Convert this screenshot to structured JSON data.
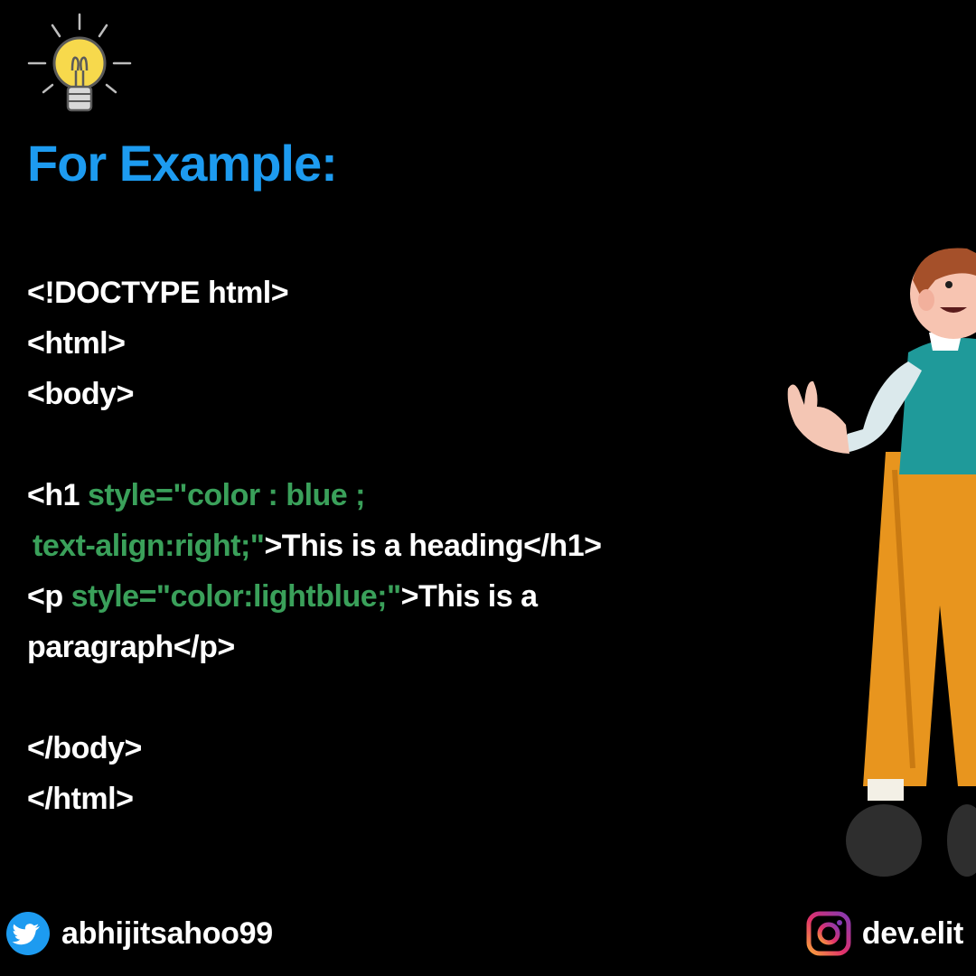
{
  "title": "For Example:",
  "icons": {
    "bulb": "lightbulb-icon",
    "twitter": "twitter-icon",
    "instagram": "instagram-icon"
  },
  "colors": {
    "background": "#000000",
    "heading": "#1d9bf0",
    "code_text": "#ffffff",
    "attribute": "#3aa05a"
  },
  "code": {
    "doctype": "<!DOCTYPE html>",
    "html_open": "<html>",
    "body_open": "<body>",
    "h1_tag": "<h1 ",
    "h1_style_1": "style=\"color : blue ;",
    "h1_style_2": "text-align:right;\"",
    "h1_close_bracket": ">",
    "h1_text": "This is a heading</h1>",
    "p_tag": "<p ",
    "p_style": "style=\"color:lightblue;\"",
    "p_close_bracket": ">",
    "p_text_1": "This is a",
    "p_text_2": "paragraph</p>",
    "body_close": "</body>",
    "html_close": "</html>"
  },
  "footer": {
    "twitter_handle": "abhijitsahoo99",
    "instagram_handle": "dev.elit"
  }
}
